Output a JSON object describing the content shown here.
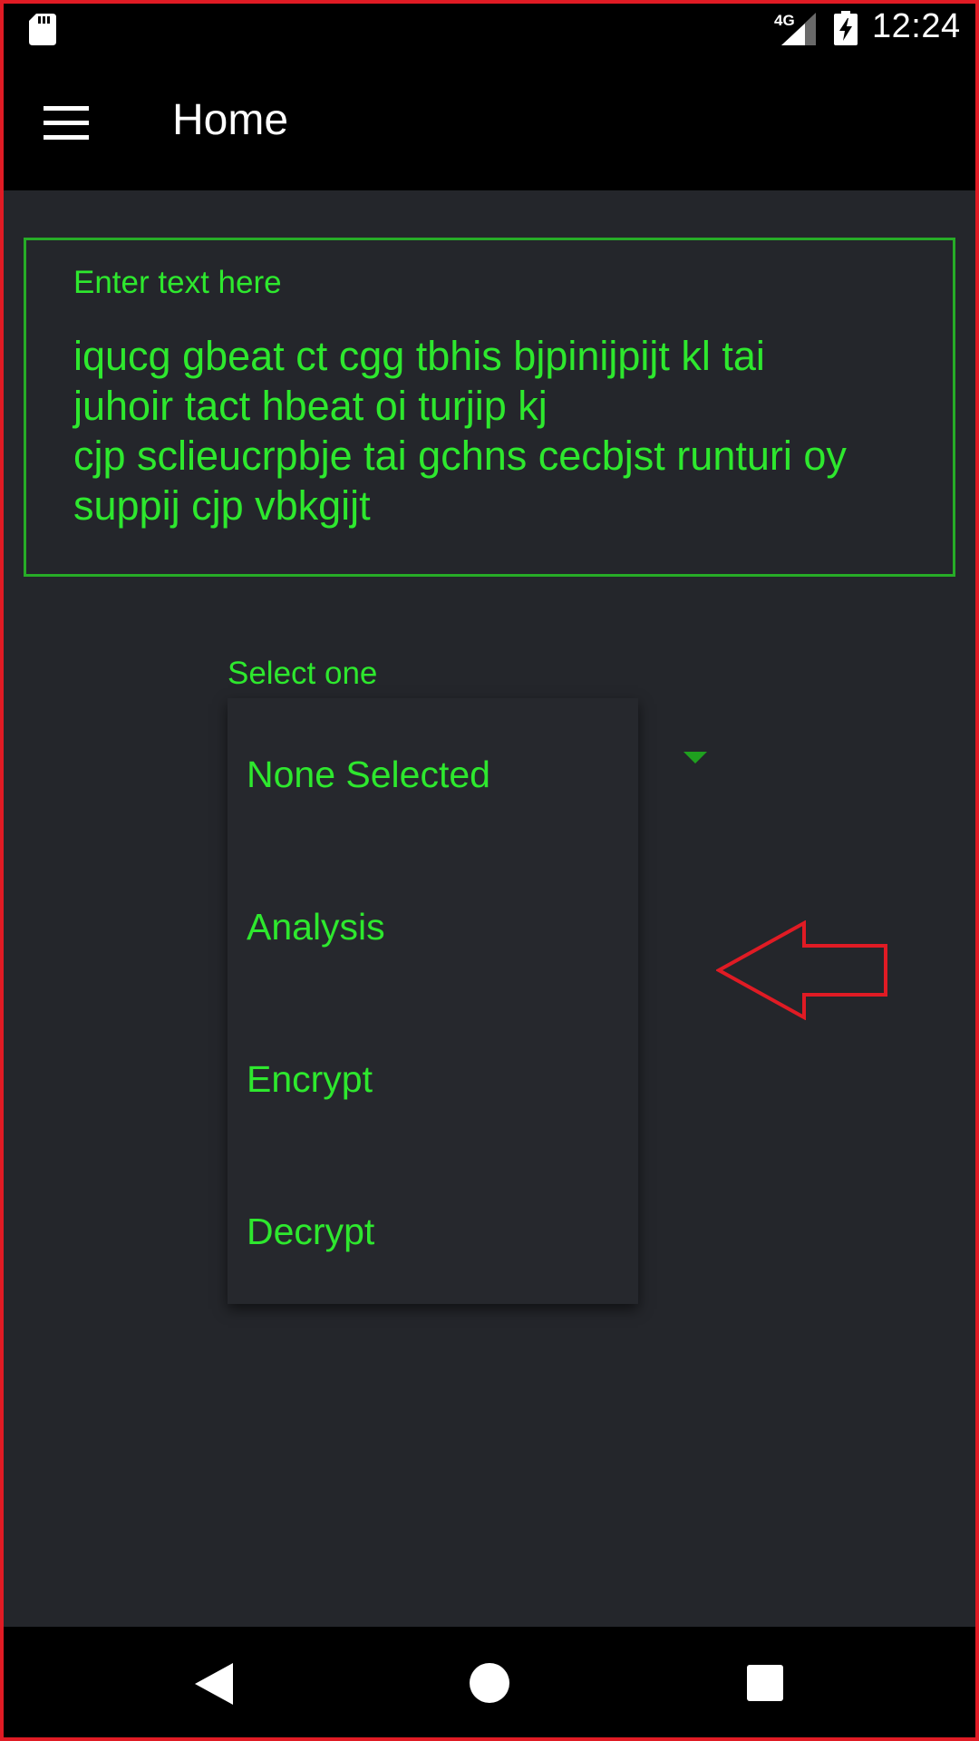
{
  "status_bar": {
    "network_label": "4G",
    "time": "12:24",
    "icons": [
      "sd-card-icon",
      "signal-icon",
      "battery-charging-icon"
    ]
  },
  "app_bar": {
    "title": "Home",
    "menu_icon": "hamburger-menu-icon"
  },
  "input": {
    "label": "Enter text here",
    "value": "iqucg gbeat ct cgg tbhis bjpinijpijt kl tai\njuhoir tact hbeat oi turjip kj\ncjp sclieucrpbje tai gchns cecbjst runturi oy\nsuppij cjp vbkgijt"
  },
  "spinner": {
    "label": "Select one",
    "options": [
      "None Selected",
      "Analysis",
      "Encrypt",
      "Decrypt"
    ]
  },
  "annotation": {
    "icon": "red-arrow-left-icon",
    "color": "#e01b24"
  },
  "nav_bar": {
    "icons": [
      "back-icon",
      "home-icon",
      "recents-icon"
    ]
  },
  "colors": {
    "accent_green": "#2ee82e",
    "border_green": "#27ac27",
    "background": "#24262b"
  }
}
